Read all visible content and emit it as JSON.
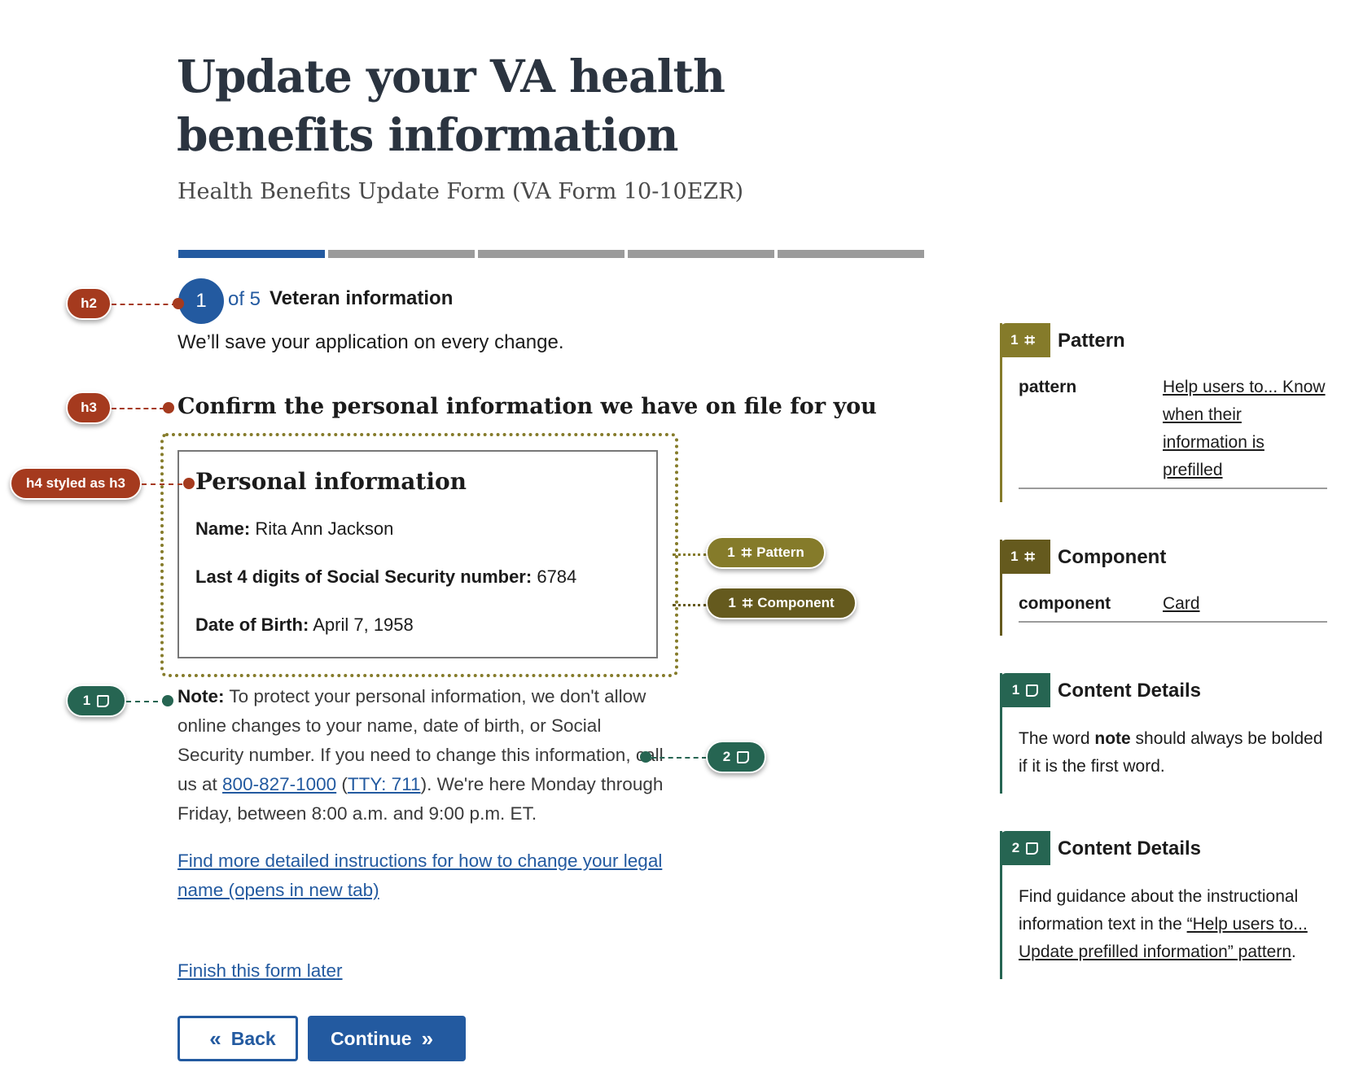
{
  "title": "Update your VA health benefits information",
  "subtitle": "Health Benefits Update Form (VA Form 10-10EZR)",
  "progress": {
    "current": 1,
    "total": 5
  },
  "step": {
    "number": "1",
    "of": "of 5",
    "title": "Veteran information"
  },
  "save_note": "We’ll save your application on every change.",
  "section_heading": "Confirm the personal information we have on file for you",
  "card": {
    "title": "Personal information",
    "rows": [
      {
        "label": "Name:",
        "value": "Rita Ann Jackson"
      },
      {
        "label": "Last 4 digits of Social Security number:",
        "value": "6784"
      },
      {
        "label": "Date of Birth:",
        "value": "April 7, 1958"
      }
    ]
  },
  "note": {
    "label": "Note:",
    "text1": "To protect your personal information, we don't allow online changes to your name, date of birth, or Social Security number. If you need to change this information, call us at",
    "phone": "800-827-1000",
    "tty": "TTY: 711",
    "text2": ". We're here Monday through Friday, between 8:00 a.m. and 9:00 p.m. ET."
  },
  "detail_link": "Find more detailed instructions for how to change your legal name (opens in new tab)",
  "finish_link": "Finish this form later",
  "buttons": {
    "back": "Back",
    "continue": "Continue"
  },
  "annotations": {
    "h2": "h2",
    "h3": "h3",
    "h4": "h4 styled as h3",
    "note1": "1",
    "note2": "2",
    "pattern_num": "1",
    "pattern": "Pattern",
    "component_num": "1",
    "component": "Component"
  },
  "panels": {
    "pattern": {
      "num": "1",
      "heading": "Pattern",
      "key": "pattern",
      "value": "Help users to... Know when their information is prefilled"
    },
    "component": {
      "num": "1",
      "heading": "Component",
      "key": "component",
      "value": "Card"
    },
    "content1": {
      "num": "1",
      "heading": "Content Details",
      "text_a": "The word ",
      "bold": "note",
      "text_b": " should always be bolded if it is the first word."
    },
    "content2": {
      "num": "2",
      "heading": "Content Details",
      "text_a": "Find guidance about the instructional information text in the ",
      "link": "“Help users to... Update prefilled information” pattern",
      "text_b": "."
    }
  },
  "colors": {
    "primary": "#235aa0",
    "heading_annot": "#a53a1e",
    "content_annot": "#266552",
    "pattern_annot": "#857b2a",
    "component_annot": "#655a1e"
  }
}
